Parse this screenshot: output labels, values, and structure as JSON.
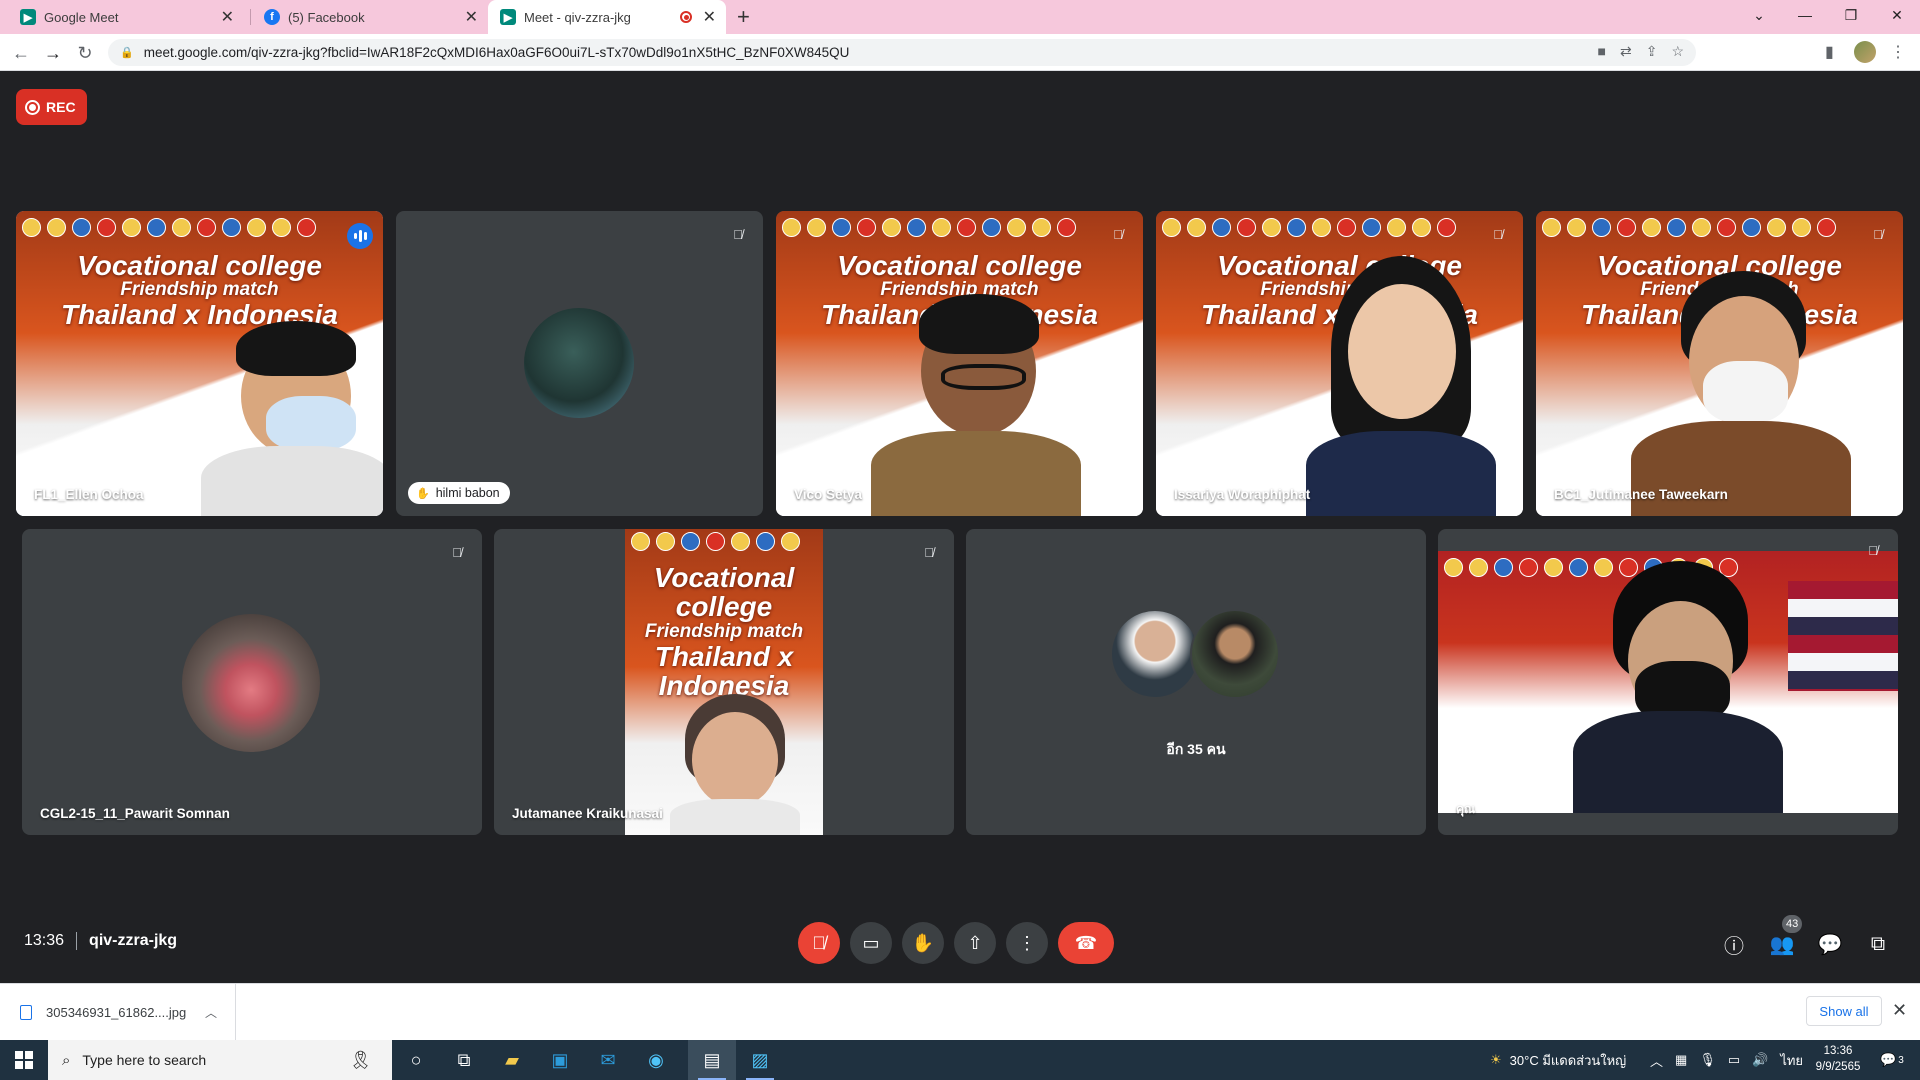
{
  "browser": {
    "tabs": [
      {
        "title": "Google Meet",
        "icon": "meet-icon"
      },
      {
        "title": "(5) Facebook",
        "icon": "facebook-icon"
      },
      {
        "title": "Meet - qiv-zzra-jkg",
        "icon": "meet-icon",
        "recording": true
      }
    ],
    "url": "meet.google.com/qiv-zzra-jkg?fbclid=IwAR18F2cQxMDI6Hax0aGF6O0ui7L-sTx70wDdl9o1nX5tHC_BzNF0XW845QU"
  },
  "meet": {
    "rec_label": "REC",
    "tiles_row1": [
      {
        "name": "FL1_Ellen Ochoa",
        "state": "speaking"
      },
      {
        "name": "hilmi babon",
        "state": "muted"
      },
      {
        "name": "Vico Setya",
        "state": "muted"
      },
      {
        "name": "Issariya Woraphiphat",
        "state": "muted"
      },
      {
        "name": "BC1_Jutimanee Taweekarn",
        "state": "muted"
      }
    ],
    "tiles_row2": [
      {
        "name": "CGL2-15_11_Pawarit Somnan",
        "state": "muted"
      },
      {
        "name": "Jutamanee Kraikunasai",
        "state": "muted"
      },
      {
        "name": "อีก 35 คน",
        "state": "overflow"
      },
      {
        "name": "คุณ",
        "state": "muted"
      }
    ],
    "banner": {
      "line1": "Vocational college",
      "line2": "Friendship match",
      "line3": "Thailand x Indonesia"
    },
    "time": "13:36",
    "meeting_code": "qiv-zzra-jkg",
    "people_count": "43",
    "accent_red": "#ea4335",
    "accent_blue": "#1a73e8"
  },
  "downloads": {
    "file": "305346931_61862....jpg",
    "show_all": "Show all"
  },
  "taskbar": {
    "search_placeholder": "Type here to search",
    "weather": "30°C มีแดดส่วนใหญ่",
    "lang": "ไทย",
    "time": "13:36",
    "date": "9/9/2565",
    "notifications": "3"
  }
}
